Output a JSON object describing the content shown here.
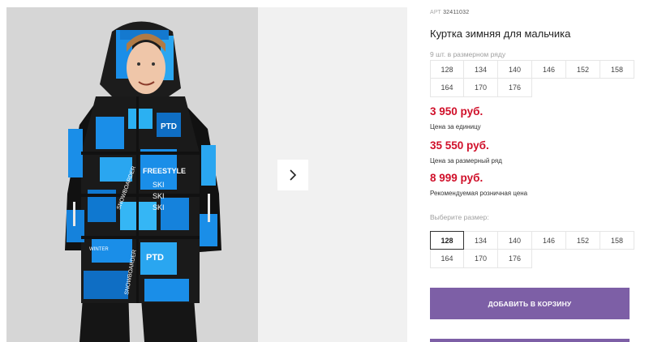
{
  "product": {
    "art_label": "АРТ",
    "art_number": "32411032",
    "title": "Куртка зимняя для мальчика",
    "pack_note": "9 шт. в размерном ряду",
    "pack_sizes": [
      "128",
      "134",
      "140",
      "146",
      "152",
      "158",
      "164",
      "170",
      "176"
    ],
    "prices": [
      {
        "value": "3 950 руб.",
        "label": "Цена за единицу"
      },
      {
        "value": "35 550 руб.",
        "label": "Цена за размерный ряд"
      },
      {
        "value": "8 999 руб.",
        "label": "Рекомендуемая розничная цена"
      }
    ],
    "choose_size_label": "Выберите размер:",
    "sizes": [
      "128",
      "134",
      "140",
      "146",
      "152",
      "158",
      "164",
      "170",
      "176"
    ],
    "selected_size": "128",
    "add_to_cart": "ДОБАВИТЬ В КОРЗИНУ"
  },
  "photo": {
    "jacket_texts": [
      "PTD",
      "FREESTYLE",
      "SKI",
      "SKI",
      "SKI",
      "SNOWBOARDER",
      "WINTER",
      "PTD",
      "SNOWBOARDER"
    ]
  },
  "colors": {
    "price": "#d0102a",
    "button": "#7d5fa6",
    "jacket_blue": "#1a8ee8"
  },
  "icons": {
    "next": "chevron-right-icon"
  }
}
